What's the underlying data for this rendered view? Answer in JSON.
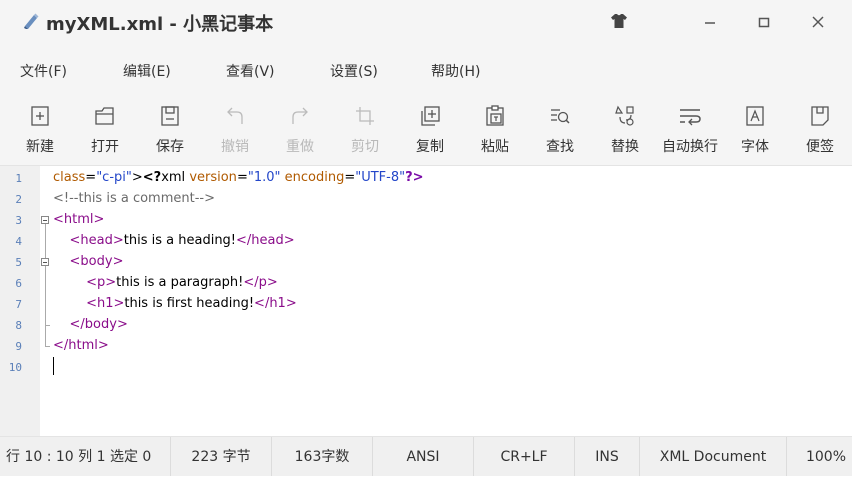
{
  "window": {
    "title": "myXML.xml - 小黑记事本",
    "icons": {
      "app": "notepad-app-icon",
      "skin": "tshirt-skin-icon",
      "minimize": "minimize-icon",
      "maximize": "maximize-icon",
      "close": "close-icon"
    }
  },
  "menu": {
    "items": [
      {
        "label": "文件(F)"
      },
      {
        "label": "编辑(E)"
      },
      {
        "label": "查看(V)"
      },
      {
        "label": "设置(S)"
      },
      {
        "label": "帮助(H)"
      }
    ]
  },
  "toolbar": {
    "items": [
      {
        "label": "新建",
        "icon": "new-file-icon",
        "enabled": true
      },
      {
        "label": "打开",
        "icon": "open-folder-icon",
        "enabled": true
      },
      {
        "label": "保存",
        "icon": "save-icon",
        "enabled": true
      },
      {
        "label": "撤销",
        "icon": "undo-icon",
        "enabled": false
      },
      {
        "label": "重做",
        "icon": "redo-icon",
        "enabled": false
      },
      {
        "label": "剪切",
        "icon": "cut-icon",
        "enabled": false
      },
      {
        "label": "复制",
        "icon": "copy-icon",
        "enabled": true
      },
      {
        "label": "粘贴",
        "icon": "paste-icon",
        "enabled": true
      },
      {
        "label": "查找",
        "icon": "find-icon",
        "enabled": true
      },
      {
        "label": "替换",
        "icon": "replace-icon",
        "enabled": true
      },
      {
        "label": "自动换行",
        "icon": "word-wrap-icon",
        "enabled": true
      },
      {
        "label": "字体",
        "icon": "font-icon",
        "enabled": true
      },
      {
        "label": "便签",
        "icon": "sticky-note-icon",
        "enabled": true
      }
    ]
  },
  "editor": {
    "line_numbers": [
      "1",
      "2",
      "3",
      "4",
      "5",
      "6",
      "7",
      "8",
      "9",
      "10"
    ],
    "lines": [
      {
        "text": "<?xml version=\"1.0\" encoding=\"UTF-8\"?>"
      },
      {
        "text": "<!--this is a comment-->"
      },
      {
        "text": "<html>"
      },
      {
        "text": "    <head>this is a heading!</head>"
      },
      {
        "text": "    <body>"
      },
      {
        "text": "        <p>this is a paragraph!</p>"
      },
      {
        "text": "        <h1>this is first heading!</h1>"
      },
      {
        "text": "    </body>"
      },
      {
        "text": "</html>"
      },
      {
        "text": ""
      }
    ],
    "colors": {
      "tag": "#8a0d8a",
      "pi": "#7a0ca8",
      "attr": "#b05a00",
      "value": "#2346c9",
      "comment": "#6a6a6a",
      "line_number": "#5a7fb8"
    }
  },
  "status": {
    "position": "行 10 : 10   列 1   选定 0",
    "bytes": "223 字节",
    "chars": "163字数",
    "encoding": "ANSI",
    "line_ending": "CR+LF",
    "insert_mode": "INS",
    "doc_type": "XML Document",
    "zoom": "100%"
  }
}
